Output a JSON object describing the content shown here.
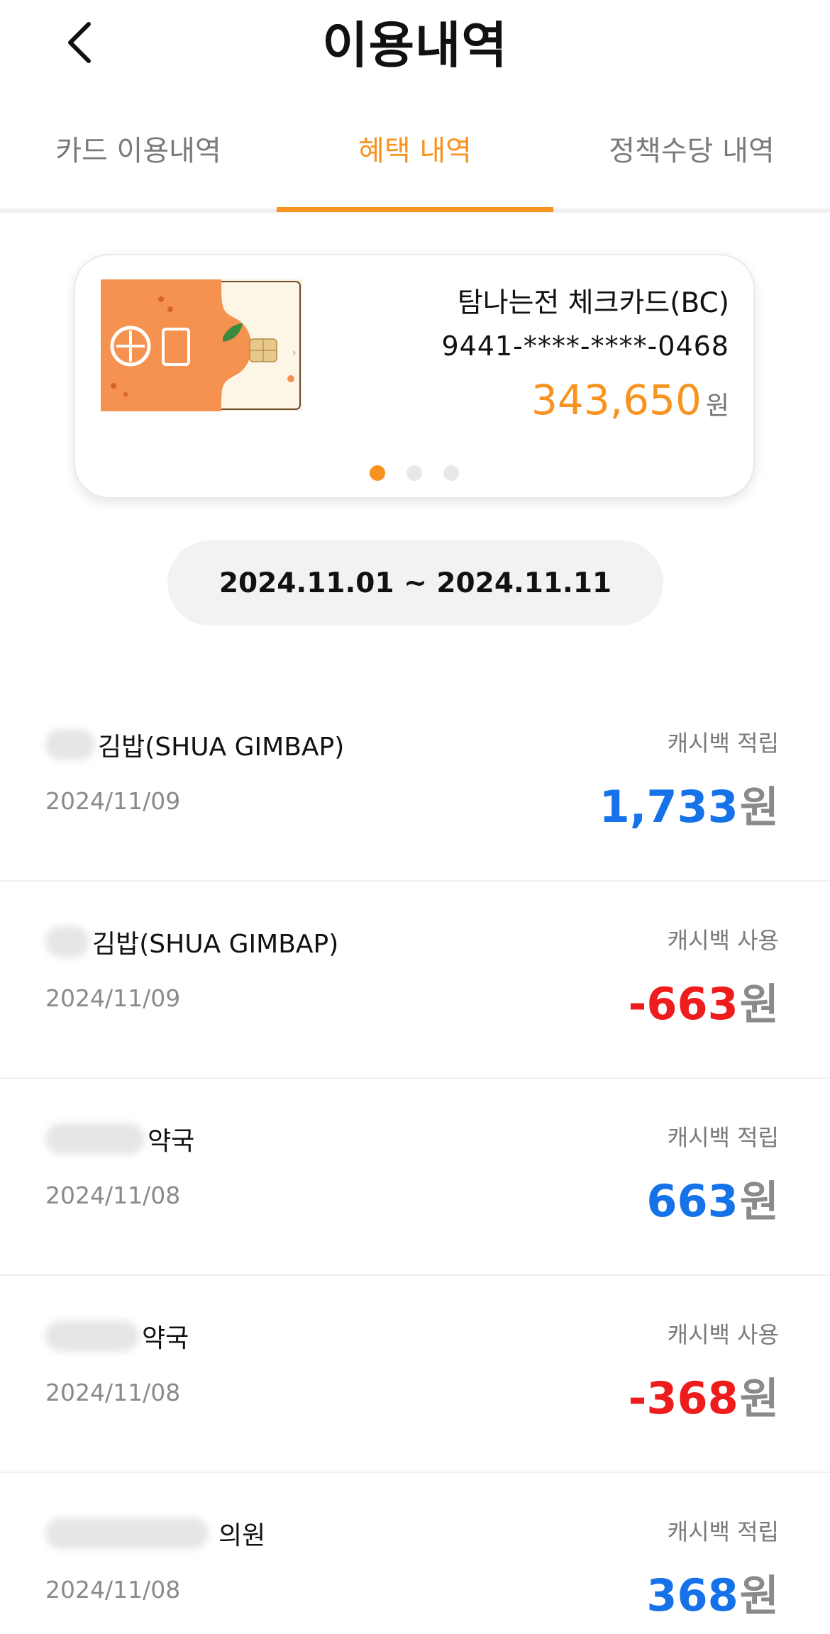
{
  "header": {
    "title": "이용내역",
    "back_icon": "chevron-left-icon"
  },
  "tabs": [
    {
      "label": "카드 이용내역",
      "active": false
    },
    {
      "label": "혜택 내역",
      "active": true
    },
    {
      "label": "정책수당 내역",
      "active": false
    }
  ],
  "card": {
    "name": "탐나는전 체크카드(BC)",
    "number": "9441-****-****-0468",
    "balance": "343,650",
    "balance_unit": "원",
    "carousel_pages": 3,
    "carousel_current": 1,
    "colors": {
      "accent": "#f7931e"
    }
  },
  "date_range": "2024.11.01 ~ 2024.11.11",
  "transactions": [
    {
      "name": "김밥(SHUA GIMBAP)",
      "date": "2024/11/09",
      "type": "캐시백 적립",
      "amount": "1,733",
      "unit": "원",
      "sign": "positive"
    },
    {
      "name": "김밥(SHUA GIMBAP)",
      "date": "2024/11/09",
      "type": "캐시백 사용",
      "amount": "-663",
      "unit": "원",
      "sign": "negative"
    },
    {
      "name": "약국",
      "date": "2024/11/08",
      "type": "캐시백 적립",
      "amount": "663",
      "unit": "원",
      "sign": "positive"
    },
    {
      "name": "약국",
      "date": "2024/11/08",
      "type": "캐시백 사용",
      "amount": "-368",
      "unit": "원",
      "sign": "negative"
    },
    {
      "name": "의원",
      "date": "2024/11/08",
      "type": "캐시백 적립",
      "amount": "368",
      "unit": "원",
      "sign": "positive"
    }
  ],
  "colors": {
    "accent": "#f7931e",
    "positive": "#1572e8",
    "negative": "#ee1c1c"
  }
}
